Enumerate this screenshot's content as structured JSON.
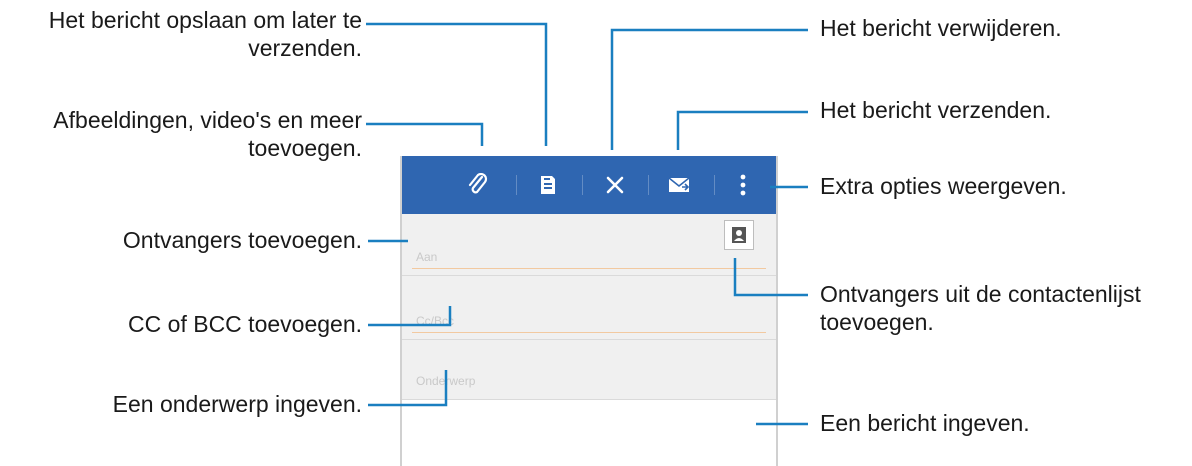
{
  "app": {
    "toolbar": {
      "accent": "#2f66b1",
      "buttons": [
        {
          "icon": "paperclip-icon"
        },
        {
          "icon": "save-draft-icon"
        },
        {
          "icon": "close-icon"
        },
        {
          "icon": "send-mail-icon"
        },
        {
          "icon": "more-options-icon"
        }
      ]
    },
    "fields": [
      {
        "name": "recipients",
        "hint": "Aan"
      },
      {
        "name": "cc-bcc",
        "hint": "Cc/Bcc"
      },
      {
        "name": "subject",
        "hint": "Onderwerp"
      }
    ]
  },
  "callouts": {
    "save_line1": "Het bericht opslaan om later te",
    "save_line2": "verzenden.",
    "attach_line1": "Afbeeldingen, video's en meer",
    "attach_line2": "toevoegen.",
    "recipients": "Ontvangers toevoegen.",
    "ccbcc": "CC of BCC toevoegen.",
    "subject": "Een onderwerp ingeven.",
    "delete": "Het bericht verwijderen.",
    "send": "Het bericht verzenden.",
    "more": "Extra opties weergeven.",
    "contacts_line1": "Ontvangers uit de contactenlijst",
    "contacts_line2": "toevoegen.",
    "body": "Een bericht ingeven."
  },
  "line_color": "#1a7fc0"
}
